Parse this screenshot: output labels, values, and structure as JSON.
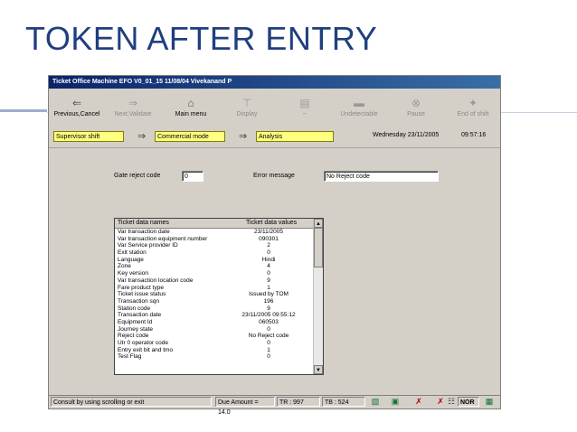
{
  "slide": {
    "title": "TOKEN AFTER ENTRY"
  },
  "window": {
    "title": "Ticket Office Machine EFO V0_01_15 11/08/04 Vivekanand P"
  },
  "toolbar": {
    "buttons": [
      {
        "label": "Previous,Cancel",
        "icon": "arrow-left-icon"
      },
      {
        "label": "Next,Validate",
        "icon": "arrow-right-icon"
      },
      {
        "label": "Main menu",
        "icon": "house-icon"
      },
      {
        "label": "Display",
        "icon": "pin-icon"
      },
      {
        "label": "--",
        "icon": "document-icon"
      },
      {
        "label": "Undetectable",
        "icon": "card-icon"
      },
      {
        "label": "Pause",
        "icon": "close-circle-icon"
      },
      {
        "label": "End of shift",
        "icon": "runner-icon"
      }
    ]
  },
  "status": {
    "shift": "Supervisor shift",
    "mode": "Commercial mode",
    "screen": "Analysis",
    "date": "Wednesday 23/11/2005",
    "time": "09:57:16"
  },
  "form": {
    "gate_reject_label": "Gate reject code",
    "gate_reject_value": "0",
    "error_label": "Error message",
    "error_value": "No Reject code"
  },
  "table": {
    "headers": [
      "Ticket data names",
      "Ticket data values"
    ],
    "rows": [
      [
        "Var transaction date",
        "23/11/2005"
      ],
      [
        "Var transaction equipment number",
        "090301"
      ],
      [
        "Var Service provider ID",
        "2"
      ],
      [
        "Exit station",
        "0"
      ],
      [
        "Language",
        "Hindi"
      ],
      [
        "Zone",
        "4"
      ],
      [
        "Key version",
        "0"
      ],
      [
        "Var transaction location code",
        "9"
      ],
      [
        "Fare product type",
        "1"
      ],
      [
        "Ticket issue status",
        "Issued by TOM"
      ],
      [
        "Transaction sqn",
        "196"
      ],
      [
        "Station code",
        "9"
      ],
      [
        "Transaction date",
        "23/11/2005 09:55:12"
      ],
      [
        "Equipment Id",
        "060503"
      ],
      [
        "Journey state",
        "0"
      ],
      [
        "Reject code",
        "No Reject code"
      ],
      [
        "Utr 0 operator code",
        "0"
      ],
      [
        "Entry exit bit and tmo",
        "1"
      ],
      [
        "Test Flag",
        "0"
      ]
    ]
  },
  "statusbar": {
    "hint": "Consult by using scrolling or exit",
    "due": "Due Amount = 14.0",
    "tr": "TR : 997",
    "tb": "TB : 524",
    "nor": "NOR"
  }
}
